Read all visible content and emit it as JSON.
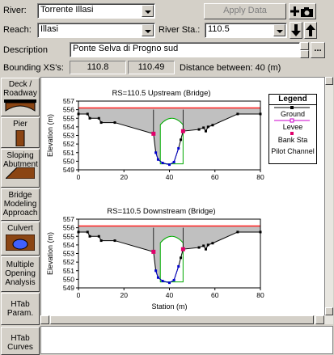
{
  "header": {
    "river_label": "River:",
    "river_value": "Torrente Illasi",
    "apply_label": "Apply Data",
    "reach_label": "Reach:",
    "reach_value": "Illasi",
    "riversta_label": "River Sta.:",
    "riversta_value": "110.5",
    "description_label": "Description",
    "description_value": "Ponte Selva di Progno sud",
    "more_label": "...",
    "bounding_label": "Bounding XS's:",
    "bounding_upstream": "110.8",
    "bounding_downstream": "110.49",
    "distance_text": "Distance between: 40 (m)"
  },
  "toolbar": {
    "items": [
      {
        "label": "Deck / Roadway",
        "icon": "deck-icon"
      },
      {
        "label": "Pier",
        "icon": "pier-icon"
      },
      {
        "label": "Sloping Abutment",
        "icon": "abutment-icon"
      },
      {
        "label": "Bridge Modeling Approach",
        "icon": ""
      },
      {
        "label": "Culvert",
        "icon": "culvert-icon"
      },
      {
        "label": "Multiple Opening Analysis",
        "icon": ""
      },
      {
        "label": "HTab Param.",
        "icon": ""
      },
      {
        "label": "HTab Curves",
        "icon": ""
      }
    ]
  },
  "colors": {
    "ground": "#000000",
    "levee": "#cc00cc",
    "bank": "#e0006a",
    "deck": "#ff2020",
    "fill": "#c0c0c0",
    "pier": "#00aa00",
    "chord": "#0000cc"
  },
  "legend": {
    "title": "Legend",
    "items": [
      "Ground",
      "Levee",
      "Bank Sta",
      "Pilot Channel"
    ]
  },
  "chart_data": [
    {
      "type": "line",
      "title": "RS=110.5   Upstream  (Bridge)",
      "xlabel": "",
      "ylabel": "Elevation (m)",
      "xlim": [
        0,
        80
      ],
      "ylim": [
        549,
        557
      ],
      "xticks": [
        0,
        20,
        40,
        60,
        80
      ],
      "yticks": [
        549,
        550,
        551,
        552,
        553,
        554,
        555,
        556,
        557
      ],
      "ground": {
        "x": [
          0,
          4,
          5,
          9,
          10,
          16,
          33,
          34,
          35,
          37,
          40,
          42,
          44,
          45,
          46,
          53,
          55,
          56,
          57,
          59,
          70,
          80
        ],
        "y": [
          555.5,
          555.5,
          555,
          555,
          554.5,
          554.5,
          553.2,
          551,
          550.2,
          549.8,
          549.6,
          549.9,
          551.5,
          552.5,
          553.5,
          553.7,
          553.9,
          553.5,
          554,
          554.2,
          555.5,
          555.5
        ]
      },
      "bank_stations": [
        {
          "x": 33,
          "y": 553.2
        },
        {
          "x": 46,
          "y": 553.5
        }
      ],
      "deck_elev": 556.2,
      "low_chord": 556,
      "pier": {
        "x": 41,
        "top": 555,
        "bottom": 549.7,
        "width": 5
      }
    },
    {
      "type": "line",
      "title": "RS=110.5   Downstream  (Bridge)",
      "xlabel": "Station (m)",
      "ylabel": "Elevation (m)",
      "xlim": [
        0,
        80
      ],
      "ylim": [
        549,
        557
      ],
      "xticks": [
        0,
        20,
        40,
        60,
        80
      ],
      "yticks": [
        549,
        550,
        551,
        552,
        553,
        554,
        555,
        556,
        557
      ],
      "ground": {
        "x": [
          0,
          4,
          5,
          9,
          10,
          16,
          33,
          34,
          35,
          37,
          40,
          42,
          44,
          45,
          46,
          53,
          55,
          56,
          57,
          59,
          70,
          80
        ],
        "y": [
          555.5,
          555.5,
          555,
          555,
          554.5,
          554.5,
          553.2,
          551,
          550.2,
          549.8,
          549.6,
          549.9,
          551.5,
          552.5,
          553.5,
          553.7,
          553.9,
          553.5,
          554,
          554.2,
          555.5,
          555.5
        ]
      },
      "bank_stations": [
        {
          "x": 33,
          "y": 553.2
        },
        {
          "x": 46,
          "y": 553.5
        }
      ],
      "deck_elev": 556.2,
      "low_chord": 556,
      "pier": {
        "x": 41,
        "top": 555,
        "bottom": 549.7,
        "width": 5
      }
    }
  ]
}
